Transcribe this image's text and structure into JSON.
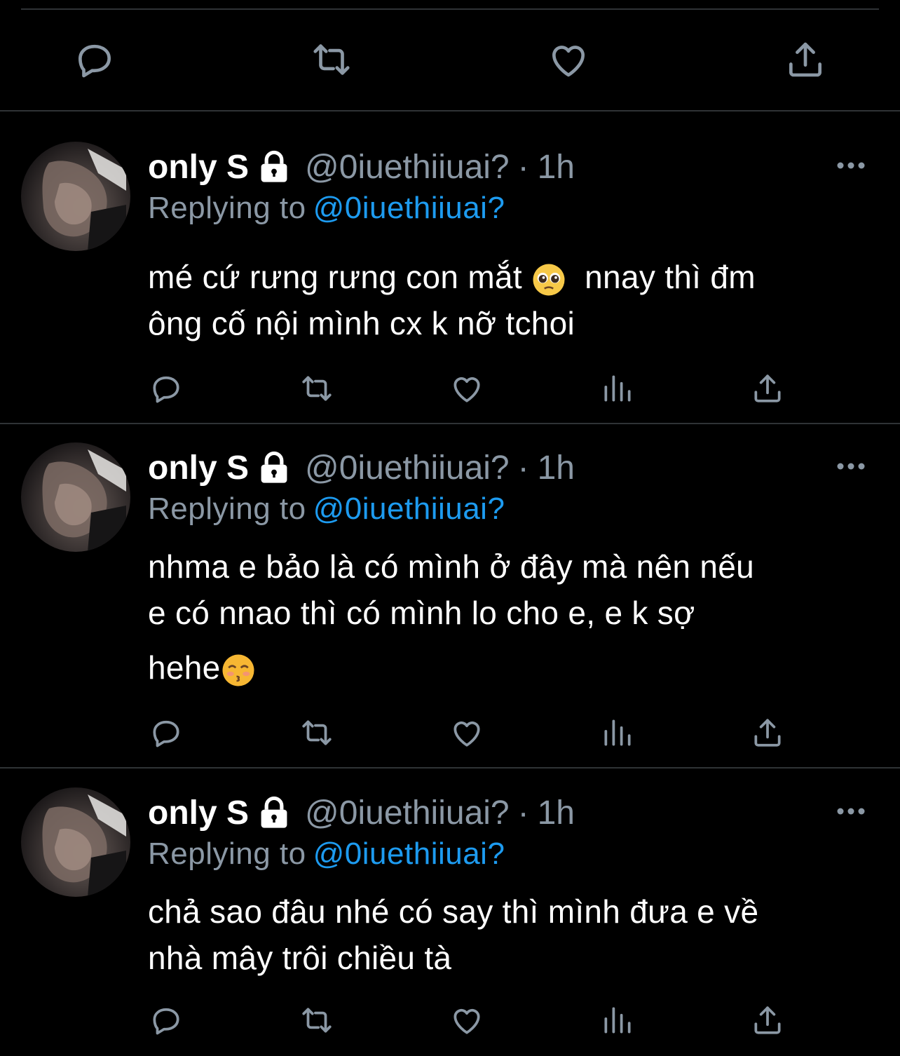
{
  "colors": {
    "background": "#000000",
    "text": "#ffffff",
    "muted": "#8b98a5",
    "link": "#1d9bf0",
    "divider": "#2f3336"
  },
  "top_actions": [
    "reply-icon",
    "retweet-icon",
    "like-icon",
    "share-icon"
  ],
  "tweets": [
    {
      "name": "only S",
      "handle": "@0iuethiiuai?",
      "dot": "·",
      "time": "1h",
      "replying_label": "Replying to",
      "replying_to": "@0iuethiiuai?",
      "line1": "mé cứ rưng rưng con mắt",
      "emoji1": "pleading-face",
      "line1b": "nnay thì đm",
      "line2": "ông cố nội mình cx k nỡ tchoi"
    },
    {
      "name": "only S",
      "handle": "@0iuethiiuai?",
      "dot": "·",
      "time": "1h",
      "replying_label": "Replying to",
      "replying_to": "@0iuethiiuai?",
      "line1": "nhma e bảo là có mình ở đây mà nên nếu",
      "line2": "e có nnao thì có mình lo cho e, e k sợ",
      "line3": "hehe",
      "emoji1": "kissing-face"
    },
    {
      "name": "only S",
      "handle": "@0iuethiiuai?",
      "dot": "·",
      "time": "1h",
      "replying_label": "Replying to",
      "replying_to": "@0iuethiiuai?",
      "line1": "chả sao đâu nhé có say thì mình đưa e về",
      "line2": "nhà mây trôi chiều tà"
    }
  ]
}
